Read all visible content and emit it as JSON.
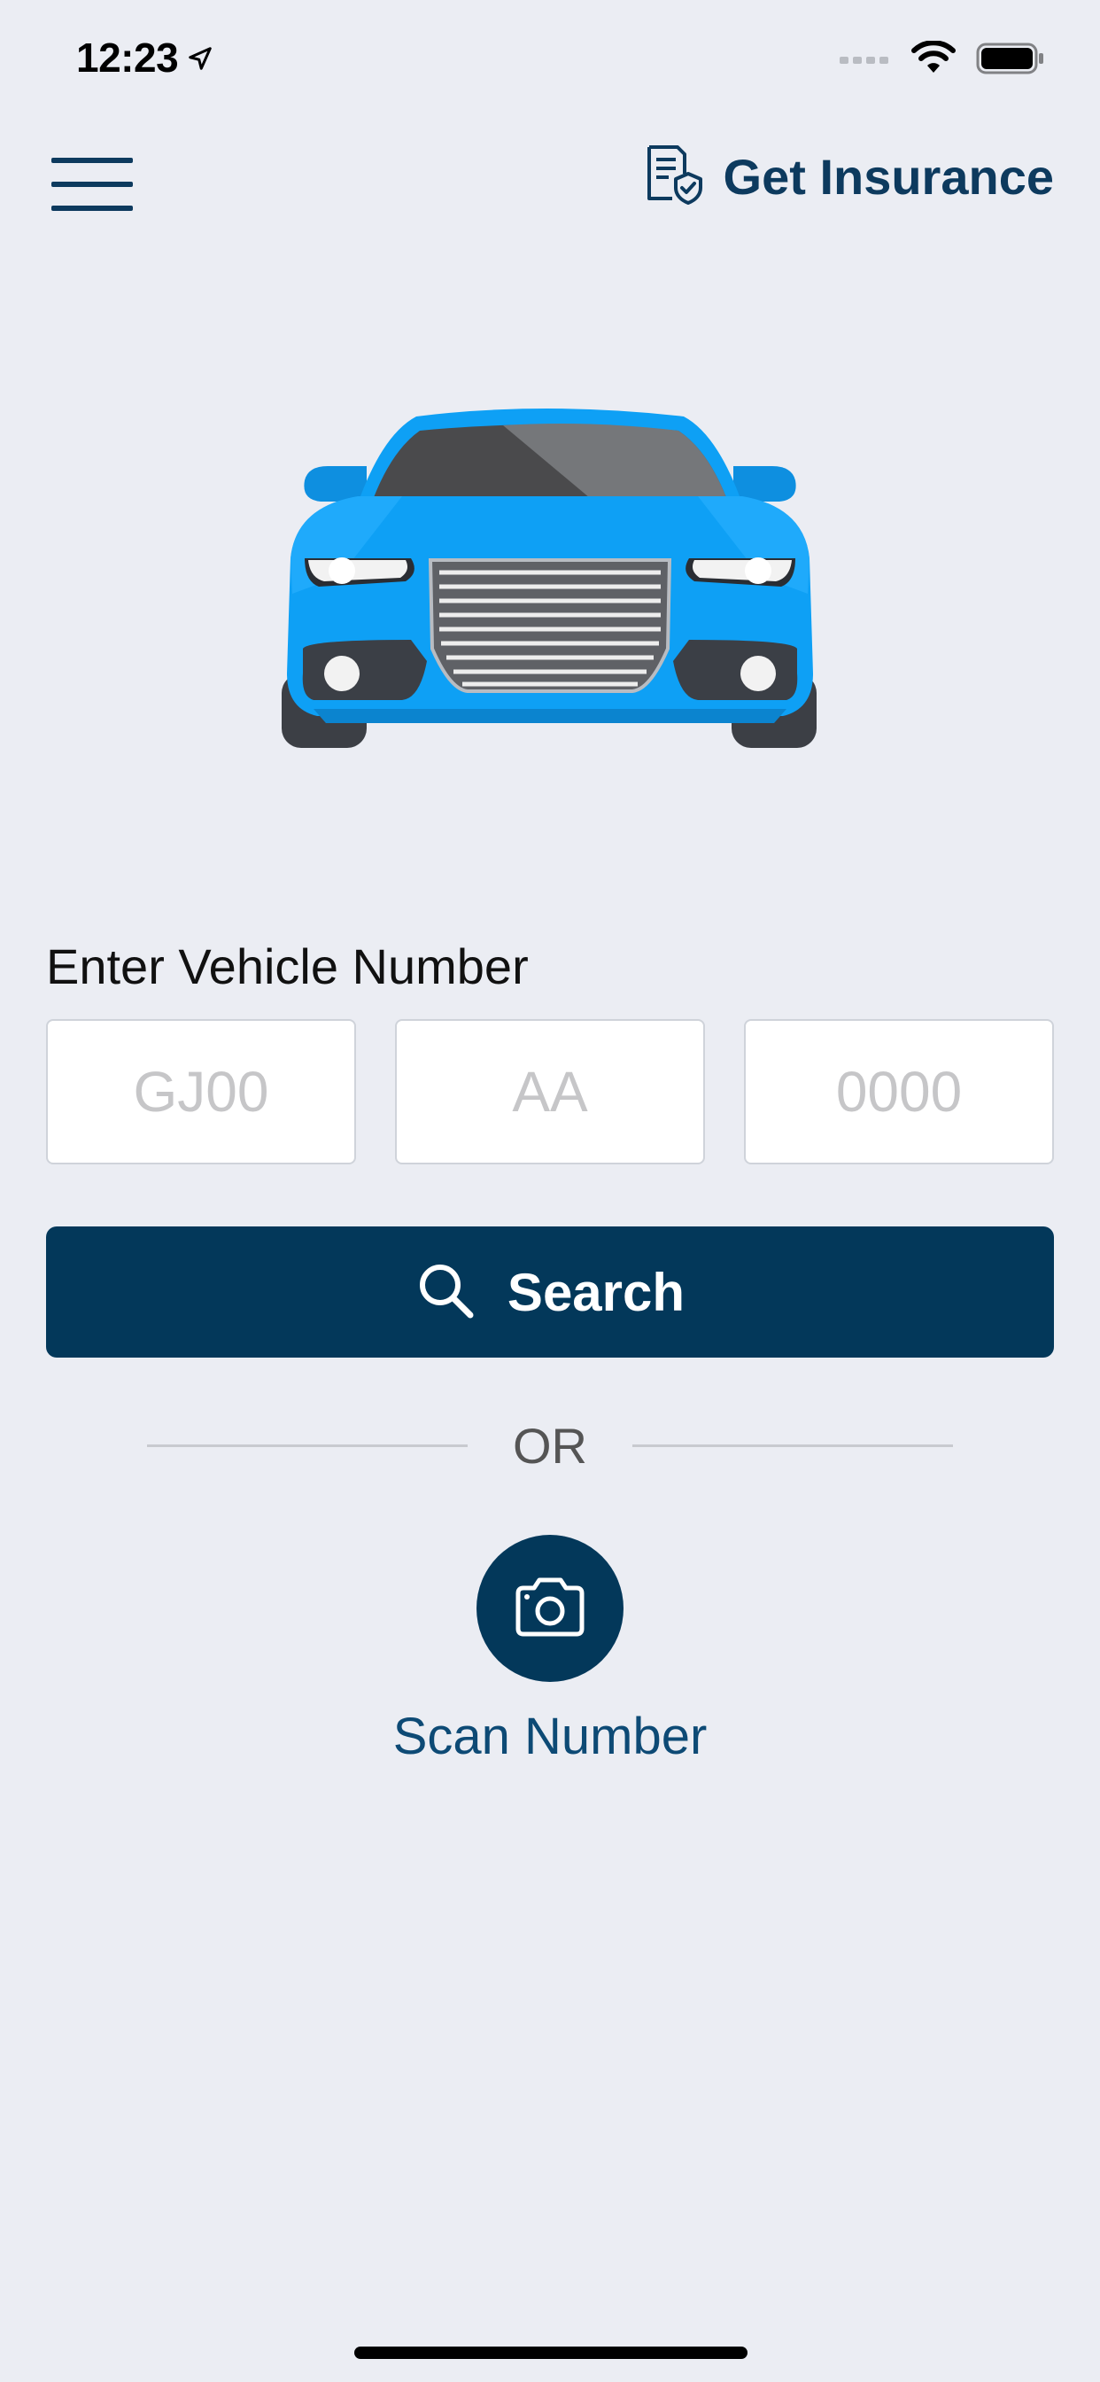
{
  "status_bar": {
    "time": "12:23",
    "icons": [
      "location-arrow-icon",
      "cellular-signal-icon",
      "wifi-icon",
      "battery-icon"
    ]
  },
  "header": {
    "menu_icon": "hamburger-menu-icon",
    "get_insurance_icon": "insurance-document-shield-icon",
    "get_insurance_label": "Get Insurance"
  },
  "hero": {
    "illustration": "blue-car-illustration"
  },
  "vehicle_form": {
    "label": "Enter Vehicle Number",
    "fields": [
      {
        "placeholder": "GJ00",
        "value": ""
      },
      {
        "placeholder": "AA",
        "value": ""
      },
      {
        "placeholder": "0000",
        "value": ""
      }
    ],
    "search_label": "Search",
    "search_icon": "search-icon"
  },
  "divider": {
    "text": "OR"
  },
  "scan": {
    "icon": "camera-icon",
    "label": "Scan Number"
  },
  "colors": {
    "background": "#ebedf3",
    "primary": "#03385a",
    "accent_text": "#0d3a5e",
    "car_blue": "#0ea0f5"
  }
}
